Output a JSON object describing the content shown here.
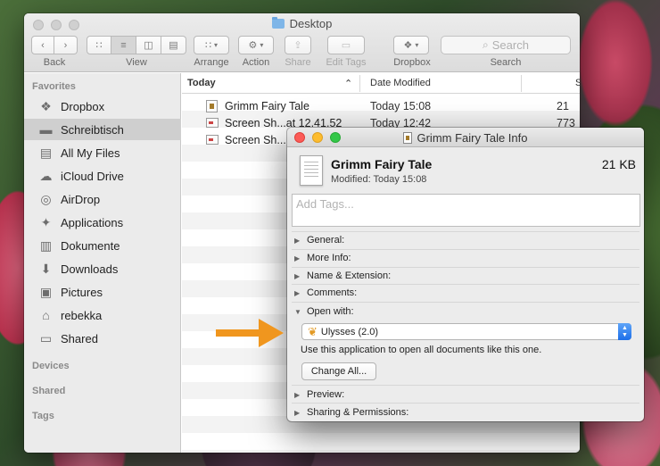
{
  "finder": {
    "title": "Desktop",
    "toolbar": {
      "back_label": "Back",
      "view_label": "View",
      "arrange_label": "Arrange",
      "action_label": "Action",
      "share_label": "Share",
      "edit_tags_label": "Edit Tags",
      "dropbox_label": "Dropbox",
      "search_label": "Search",
      "search_placeholder": "Search"
    },
    "sidebar": {
      "favorites_heading": "Favorites",
      "devices_heading": "Devices",
      "shared_heading": "Shared",
      "tags_heading": "Tags",
      "items": [
        {
          "label": "Dropbox",
          "icon": "dropbox-icon"
        },
        {
          "label": "Schreibtisch",
          "icon": "desktop-icon"
        },
        {
          "label": "All My Files",
          "icon": "all-files-icon"
        },
        {
          "label": "iCloud Drive",
          "icon": "cloud-icon"
        },
        {
          "label": "AirDrop",
          "icon": "airdrop-icon"
        },
        {
          "label": "Applications",
          "icon": "applications-icon"
        },
        {
          "label": "Dokumente",
          "icon": "document-icon"
        },
        {
          "label": "Downloads",
          "icon": "download-icon"
        },
        {
          "label": "Pictures",
          "icon": "camera-icon"
        },
        {
          "label": "rebekka",
          "icon": "home-icon"
        },
        {
          "label": "Shared",
          "icon": "folder-icon"
        }
      ]
    },
    "list": {
      "col_name": "Today",
      "col_date": "Date Modified",
      "col_size": "S",
      "rows": [
        {
          "name": "Grimm Fairy Tale",
          "date": "Today 15:08",
          "size": "21"
        },
        {
          "name": "Screen Sh...at 12.41.52",
          "date": "Today 12:42",
          "size": "773"
        },
        {
          "name": "Screen Sh...",
          "date": "",
          "size": ""
        }
      ]
    }
  },
  "info": {
    "title": "Grimm Fairy Tale Info",
    "name": "Grimm Fairy Tale",
    "size": "21 KB",
    "modified": "Modified: Today 15:08",
    "tags_placeholder": "Add Tags...",
    "sections": {
      "general": "General:",
      "more_info": "More Info:",
      "name_ext": "Name & Extension:",
      "comments": "Comments:",
      "open_with": "Open with:",
      "preview": "Preview:",
      "sharing": "Sharing & Permissions:"
    },
    "open_with": {
      "app": "Ulysses (2.0)",
      "description": "Use this application to open all documents like this one.",
      "change_all": "Change All..."
    }
  },
  "colors": {
    "annotation_arrow": "#f0961e",
    "popup_accent": "#2a7df0"
  }
}
